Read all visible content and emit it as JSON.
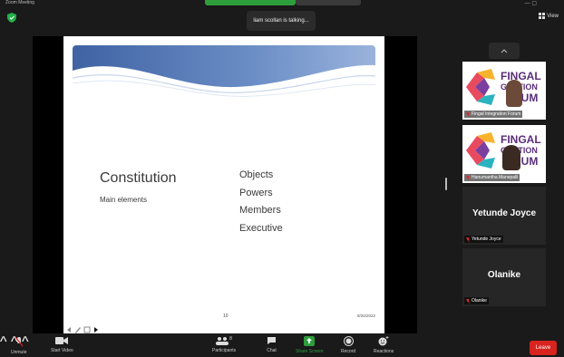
{
  "window": {
    "title": "Zoom Meeting"
  },
  "talking_indicator": "liam scollan is talking...",
  "view_button": "View",
  "slide": {
    "title": "Constitution",
    "subtitle": "Main elements",
    "items": [
      "Objects",
      "Powers",
      "Members",
      "Executive"
    ],
    "page_number": "10",
    "date": "8/26/2022",
    "banner_color": "#4a6ea8"
  },
  "participants": [
    {
      "name": "Fingal Integration Forum",
      "logo_lines": [
        "FINGAL",
        "GRATION",
        "RUM"
      ],
      "muted": true
    },
    {
      "name": "Hanumantha Manepalli",
      "logo_lines": [
        "FINGAL",
        "GRATION",
        "RUM"
      ],
      "muted": true
    },
    {
      "name": "Yetunde Joyce",
      "display": "Yetunde Joyce",
      "muted": true
    },
    {
      "name": "Olanike",
      "display": "Olanike",
      "muted": true
    }
  ],
  "toolbar": {
    "unmute": "Unmute",
    "start_video": "Start Video",
    "participants": "Participants",
    "participants_count": "8",
    "chat": "Chat",
    "share_screen": "Share Screen",
    "record": "Record",
    "reactions": "Reactions",
    "leave": "Leave"
  },
  "colors": {
    "share_green": "#2e9e3c",
    "leave_red": "#d9231e",
    "logo_purple": "#5a2d7a"
  }
}
